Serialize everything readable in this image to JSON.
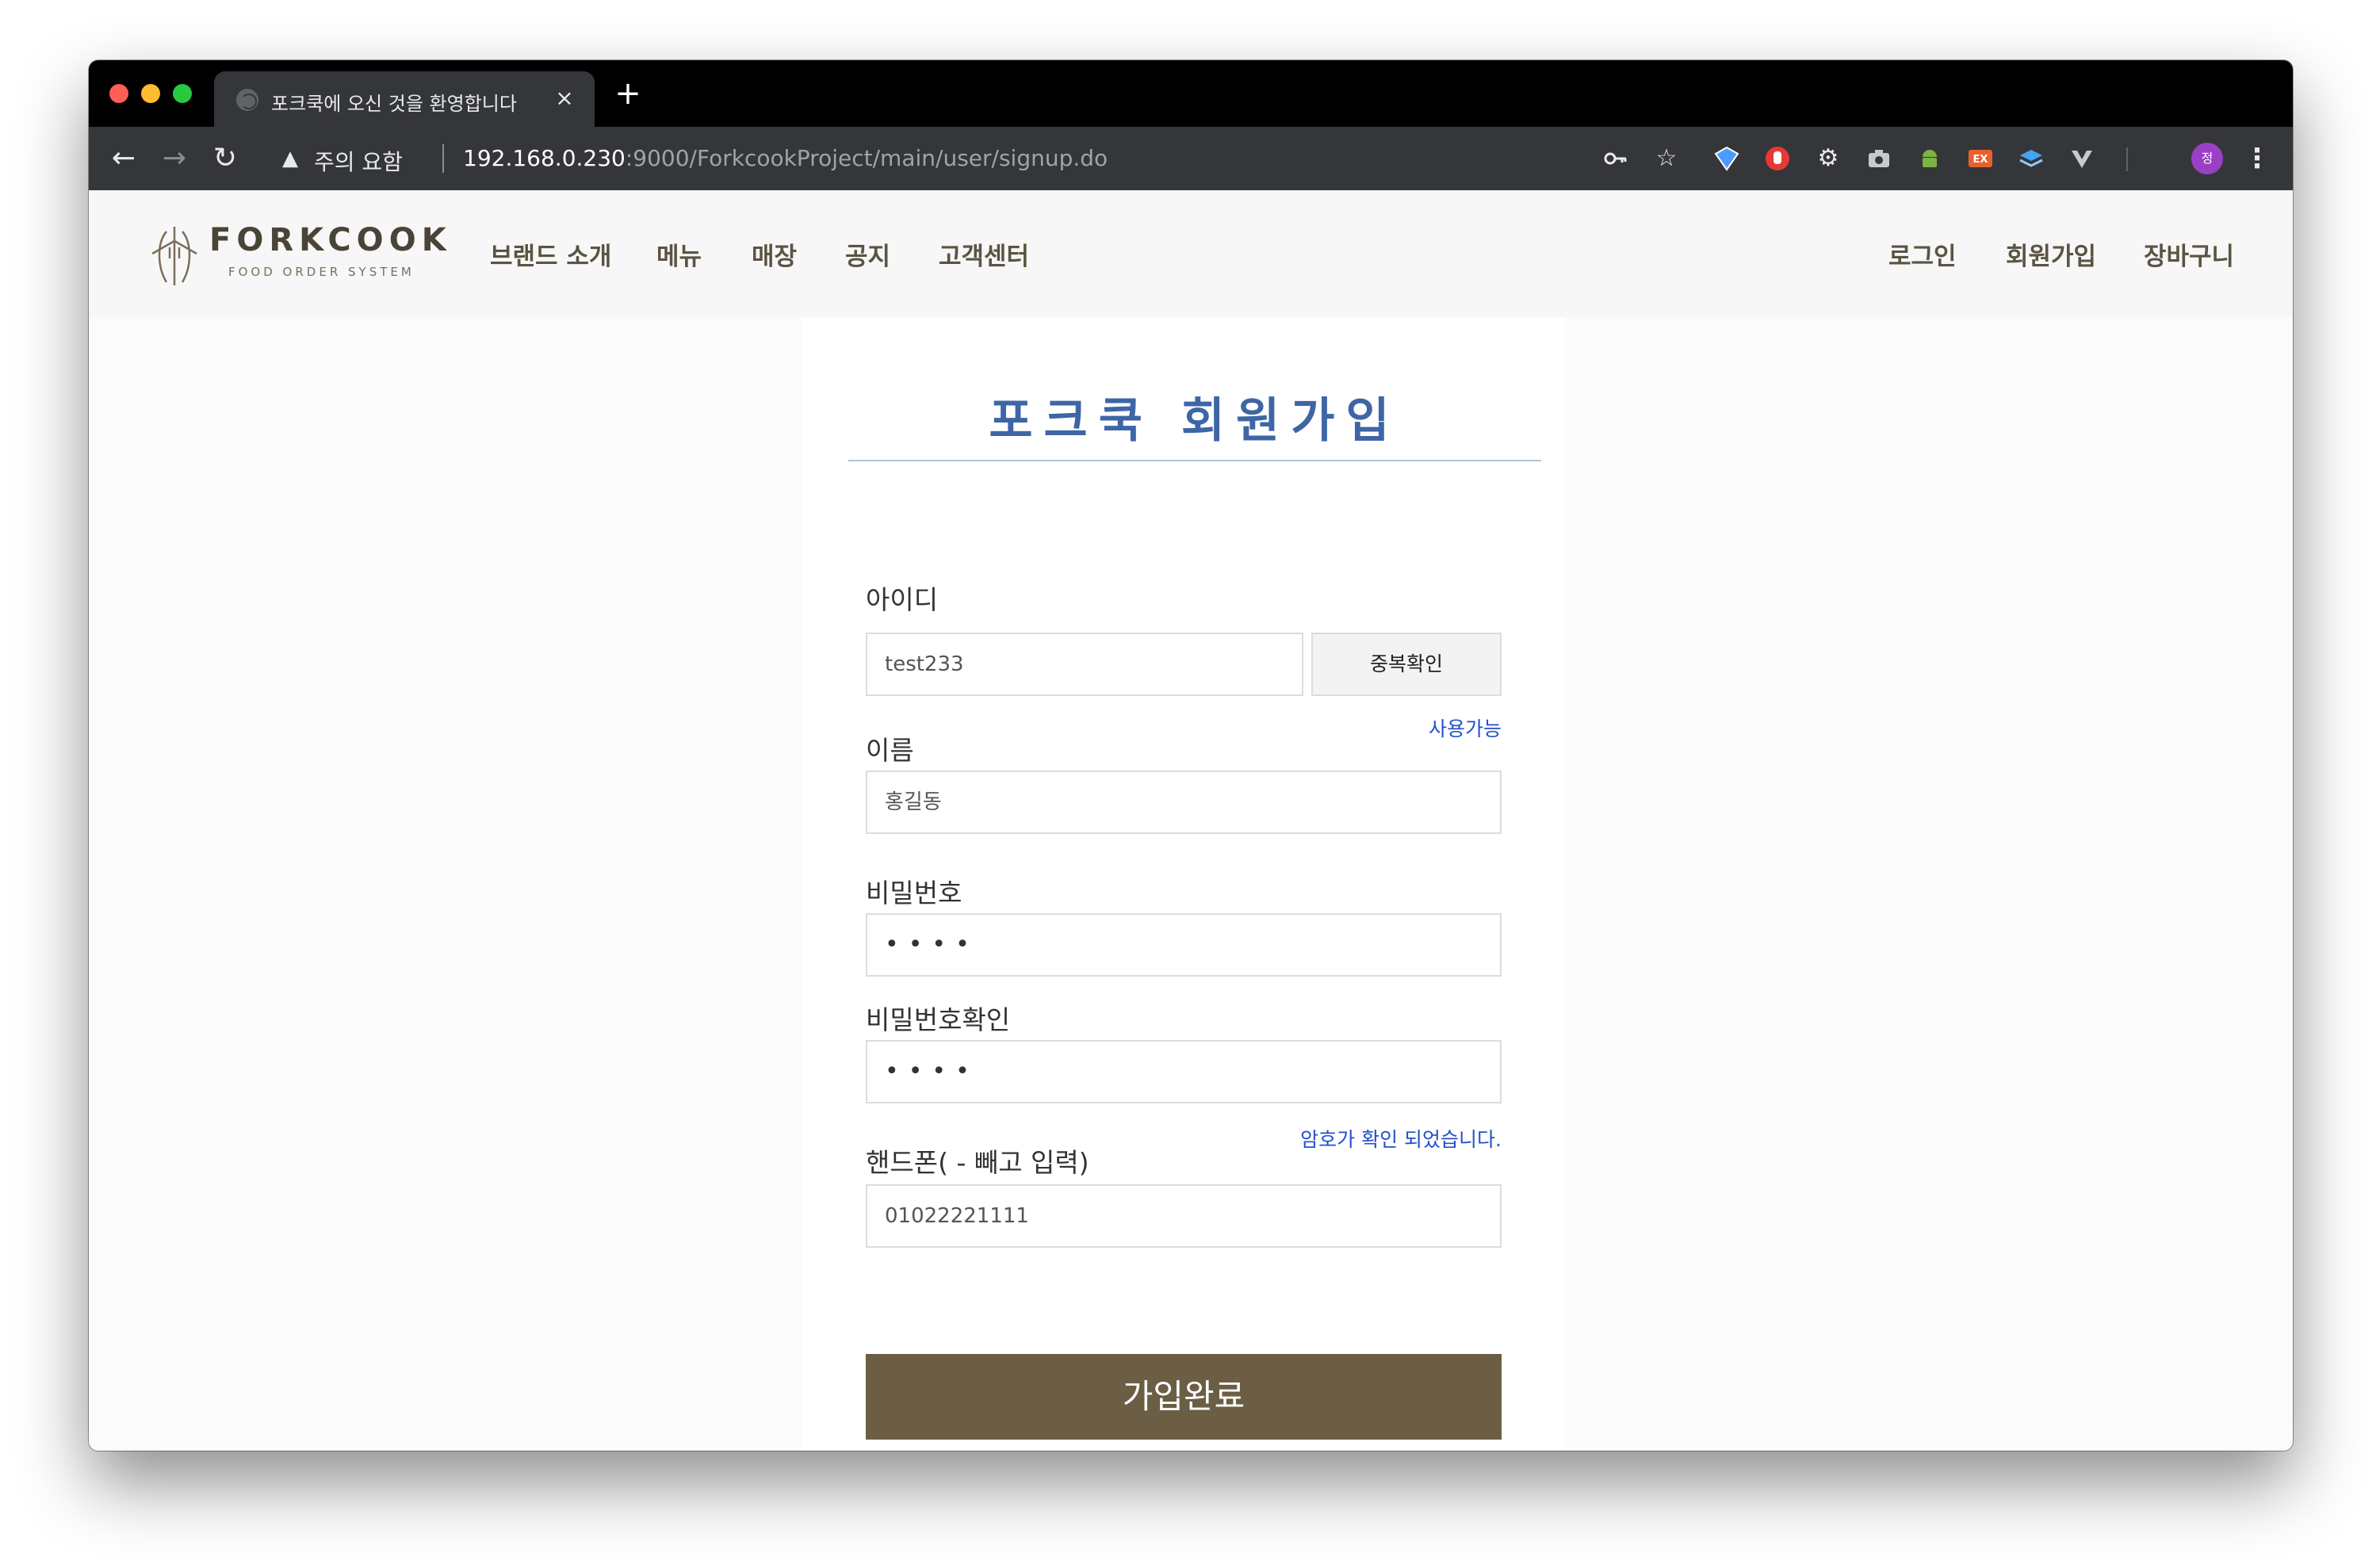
{
  "browser": {
    "tab_title": "포크쿡에 오신 것을 환영합니다",
    "tab_close": "×",
    "new_tab": "+",
    "security_label": "주의 요함",
    "url_host": "192.168.0.230",
    "url_rest": ":9000/ForkcookProject/main/user/signup.do",
    "profile_initial": "정"
  },
  "site": {
    "logo_text": "FORKCOOK",
    "logo_sub": "FOOD ORDER SYSTEM",
    "nav": [
      "브랜드 소개",
      "메뉴",
      "매장",
      "공지",
      "고객센터"
    ],
    "util_nav": [
      "로그인",
      "회원가입",
      "장바구니"
    ]
  },
  "form": {
    "title": "포크쿡 회원가입",
    "id_label": "아이디",
    "id_value": "test233",
    "dup_check_label": "중복확인",
    "id_status": "사용가능",
    "name_label": "이름",
    "name_value": "홍길동",
    "password_label": "비밀번호",
    "password_value": "••••",
    "password_confirm_label": "비밀번호확인",
    "password_confirm_value": "••••",
    "password_status": "암호가 확인 되었습니다.",
    "phone_label": "핸드폰( - 빼고 입력)",
    "phone_value": "01022221111",
    "submit_label": "가입완료"
  },
  "colors": {
    "brand": "#6b5e45",
    "title_blue": "#3e66a6",
    "hint_blue": "#2350cc"
  },
  "icons": {
    "extensions": [
      "key-icon",
      "star-icon",
      "shield-extension-icon",
      "hand-stop-icon",
      "gear-icon",
      "camera-icon",
      "android-icon",
      "ex-badge-icon",
      "layers-icon",
      "v-icon"
    ]
  }
}
